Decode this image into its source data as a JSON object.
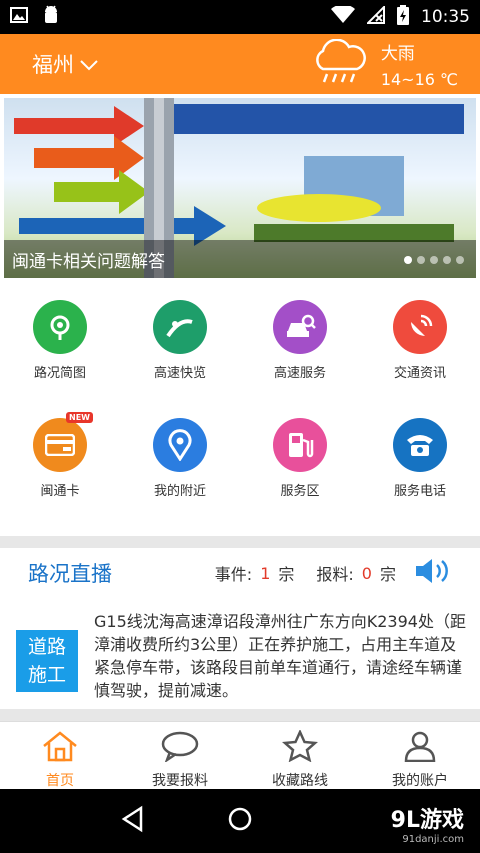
{
  "status": {
    "time": "10:35"
  },
  "header": {
    "city": "福州",
    "weather_condition": "大雨",
    "temperature": "14~16 ℃"
  },
  "banner": {
    "caption": "闽通卡相关问题解答",
    "slides": 5,
    "active_slide": 1
  },
  "grid": {
    "items": [
      {
        "label": "路况简图",
        "icon": "road-map-icon",
        "color": "#2bb24c"
      },
      {
        "label": "高速快览",
        "icon": "highway-icon",
        "color": "#1e9e6a"
      },
      {
        "label": "高速服务",
        "icon": "car-search-icon",
        "color": "#a34fc8"
      },
      {
        "label": "交通资讯",
        "icon": "satellite-icon",
        "color": "#ef4b3d"
      },
      {
        "label": "闽通卡",
        "icon": "etc-card-icon",
        "color": "#f08a1d",
        "badge": "NEW"
      },
      {
        "label": "我的附近",
        "icon": "location-pin-icon",
        "color": "#2b7de0"
      },
      {
        "label": "服务区",
        "icon": "gas-station-icon",
        "color": "#e8509b"
      },
      {
        "label": "服务电话",
        "icon": "telephone-icon",
        "color": "#1673c2"
      }
    ]
  },
  "live": {
    "title": "路况直播",
    "events_label": "事件:",
    "events_count": "1",
    "events_unit": "宗",
    "reports_label": "报料:",
    "reports_count": "0",
    "reports_unit": "宗",
    "news_badge_line1": "道路",
    "news_badge_line2": "施工",
    "news_text": "G15线沈海高速漳诏段漳州往广东方向K2394处（距漳浦收费所约3公里）正在养护施工，占用主车道及紧急停车带，该路段目前单车道通行，请途经车辆谨慎驾驶，提前减速。"
  },
  "tabs": [
    {
      "label": "首页",
      "icon": "home-icon",
      "active": true
    },
    {
      "label": "我要报料",
      "icon": "chat-bubble-icon",
      "active": false
    },
    {
      "label": "收藏路线",
      "icon": "star-icon",
      "active": false
    },
    {
      "label": "我的账户",
      "icon": "user-icon",
      "active": false
    }
  ],
  "watermark": {
    "brand": "9L游戏",
    "site": "91danji.com"
  }
}
